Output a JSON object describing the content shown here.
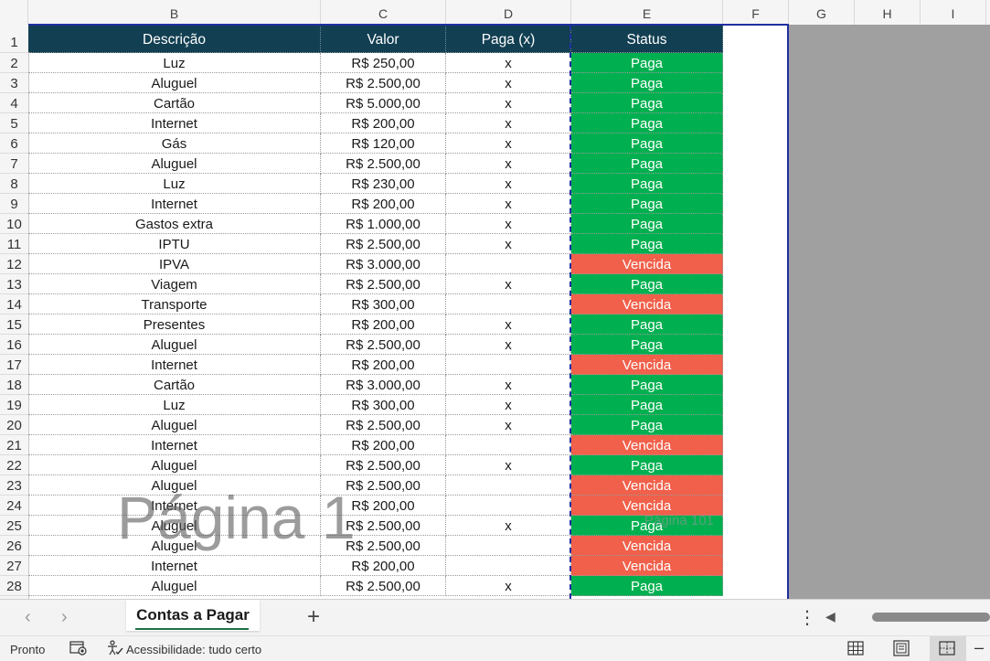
{
  "columns": [
    "B",
    "C",
    "D",
    "E",
    "F",
    "G",
    "H",
    "I"
  ],
  "headers": {
    "descricao": "Descrição",
    "valor": "Valor",
    "paga": "Paga (x)",
    "status": "Status"
  },
  "header_row_number": "1",
  "rows": [
    {
      "n": "2",
      "desc": "Luz",
      "valor": "R$ 250,00",
      "paga": "x",
      "status": "Paga"
    },
    {
      "n": "3",
      "desc": "Aluguel",
      "valor": "R$ 2.500,00",
      "paga": "x",
      "status": "Paga"
    },
    {
      "n": "4",
      "desc": "Cartão",
      "valor": "R$ 5.000,00",
      "paga": "x",
      "status": "Paga"
    },
    {
      "n": "5",
      "desc": "Internet",
      "valor": "R$ 200,00",
      "paga": "x",
      "status": "Paga"
    },
    {
      "n": "6",
      "desc": "Gás",
      "valor": "R$ 120,00",
      "paga": "x",
      "status": "Paga"
    },
    {
      "n": "7",
      "desc": "Aluguel",
      "valor": "R$ 2.500,00",
      "paga": "x",
      "status": "Paga"
    },
    {
      "n": "8",
      "desc": "Luz",
      "valor": "R$ 230,00",
      "paga": "x",
      "status": "Paga"
    },
    {
      "n": "9",
      "desc": "Internet",
      "valor": "R$ 200,00",
      "paga": "x",
      "status": "Paga"
    },
    {
      "n": "10",
      "desc": "Gastos extra",
      "valor": "R$ 1.000,00",
      "paga": "x",
      "status": "Paga"
    },
    {
      "n": "11",
      "desc": "IPTU",
      "valor": "R$ 2.500,00",
      "paga": "x",
      "status": "Paga"
    },
    {
      "n": "12",
      "desc": "IPVA",
      "valor": "R$ 3.000,00",
      "paga": "",
      "status": "Vencida"
    },
    {
      "n": "13",
      "desc": "Viagem",
      "valor": "R$ 2.500,00",
      "paga": "x",
      "status": "Paga"
    },
    {
      "n": "14",
      "desc": "Transporte",
      "valor": "R$ 300,00",
      "paga": "",
      "status": "Vencida"
    },
    {
      "n": "15",
      "desc": "Presentes",
      "valor": "R$ 200,00",
      "paga": "x",
      "status": "Paga"
    },
    {
      "n": "16",
      "desc": "Aluguel",
      "valor": "R$ 2.500,00",
      "paga": "x",
      "status": "Paga"
    },
    {
      "n": "17",
      "desc": "Internet",
      "valor": "R$ 200,00",
      "paga": "",
      "status": "Vencida"
    },
    {
      "n": "18",
      "desc": "Cartão",
      "valor": "R$ 3.000,00",
      "paga": "x",
      "status": "Paga"
    },
    {
      "n": "19",
      "desc": "Luz",
      "valor": "R$ 300,00",
      "paga": "x",
      "status": "Paga"
    },
    {
      "n": "20",
      "desc": "Aluguel",
      "valor": "R$ 2.500,00",
      "paga": "x",
      "status": "Paga"
    },
    {
      "n": "21",
      "desc": "Internet",
      "valor": "R$ 200,00",
      "paga": "",
      "status": "Vencida"
    },
    {
      "n": "22",
      "desc": "Aluguel",
      "valor": "R$ 2.500,00",
      "paga": "x",
      "status": "Paga"
    },
    {
      "n": "23",
      "desc": "Aluguel",
      "valor": "R$ 2.500,00",
      "paga": "",
      "status": "Vencida"
    },
    {
      "n": "24",
      "desc": "Internet",
      "valor": "R$ 200,00",
      "paga": "",
      "status": "Vencida"
    },
    {
      "n": "25",
      "desc": "Aluguel",
      "valor": "R$ 2.500,00",
      "paga": "x",
      "status": "Paga"
    },
    {
      "n": "26",
      "desc": "Aluguel",
      "valor": "R$ 2.500,00",
      "paga": "",
      "status": "Vencida"
    },
    {
      "n": "27",
      "desc": "Internet",
      "valor": "R$ 200,00",
      "paga": "",
      "status": "Vencida"
    },
    {
      "n": "28",
      "desc": "Aluguel",
      "valor": "R$ 2.500,00",
      "paga": "x",
      "status": "Paga"
    }
  ],
  "colors": {
    "header_bg": "#123f52",
    "paga": "#00b050",
    "vencida": "#f0604a",
    "page_break": "#1f2fa0"
  },
  "watermark": "Página 1",
  "watermark_small": "Página 101",
  "tabs": {
    "sheet_name": "Contas a Pagar",
    "add_icon": "plus-icon",
    "more_icon": "more-vertical-icon"
  },
  "status_bar": {
    "ready": "Pronto",
    "accessibility": "Acessibilidade: tudo certo"
  }
}
